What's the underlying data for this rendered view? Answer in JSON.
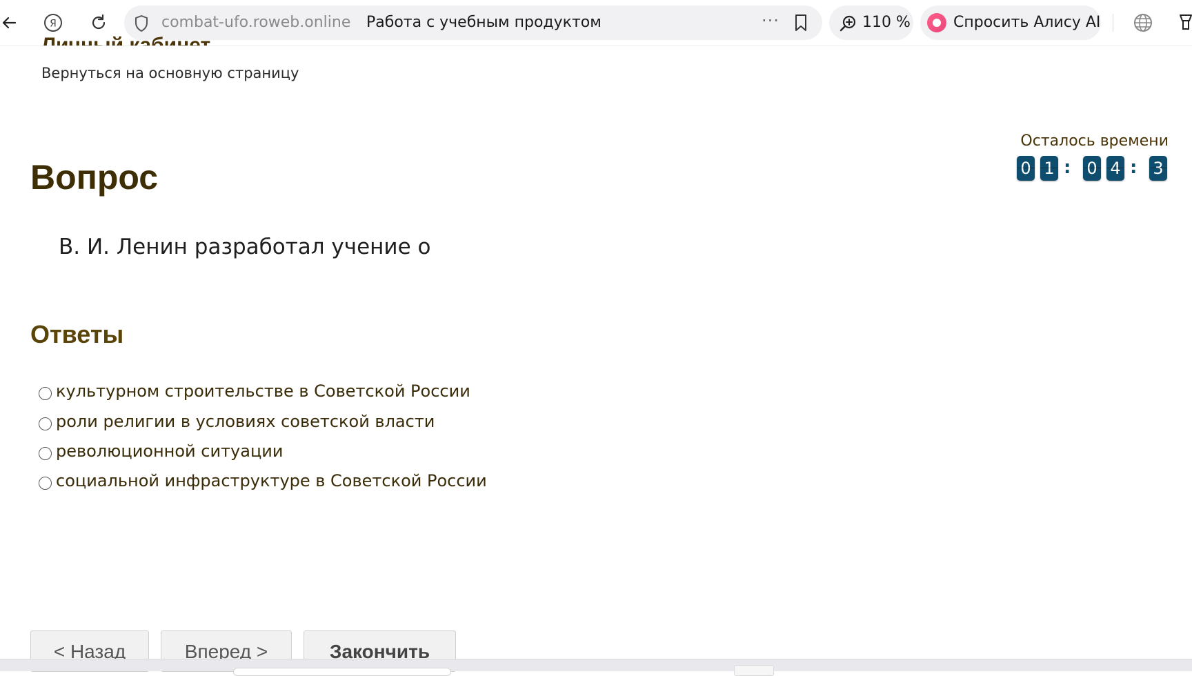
{
  "browser": {
    "domain": "combat-ufo.roweb.online",
    "page_title": "Работа с учебным продуктом",
    "more_label": "···",
    "zoom": "110 %",
    "alice_label": "Спросить Алису AI",
    "icons": [
      "back-icon",
      "yandex-icon",
      "reload-icon",
      "shield-icon",
      "bookmark-icon",
      "zoom-icon",
      "alice-icon",
      "globe-icon",
      "extension-icon"
    ]
  },
  "page": {
    "cabinet_title": "Личный кабинет",
    "back_link": "Вернуться на основную страницу",
    "timer": {
      "label": "Осталось времени",
      "h1": "0",
      "h2": "1",
      "sep1": ":",
      "m1": "0",
      "m2": "4",
      "sep2": ":",
      "s1": "3"
    },
    "question_heading": "Вопрос",
    "question_text": "В. И. Ленин разработал учение о",
    "answers_heading": "Ответы",
    "answers": [
      "культурном строительстве в Советской России",
      "роли религии в условиях советской власти",
      "революционной ситуации",
      "социальной инфраструктуре в Советской России"
    ],
    "buttons": {
      "back": "< Назад",
      "forward": "Вперед >",
      "finish": "Закончить"
    }
  }
}
